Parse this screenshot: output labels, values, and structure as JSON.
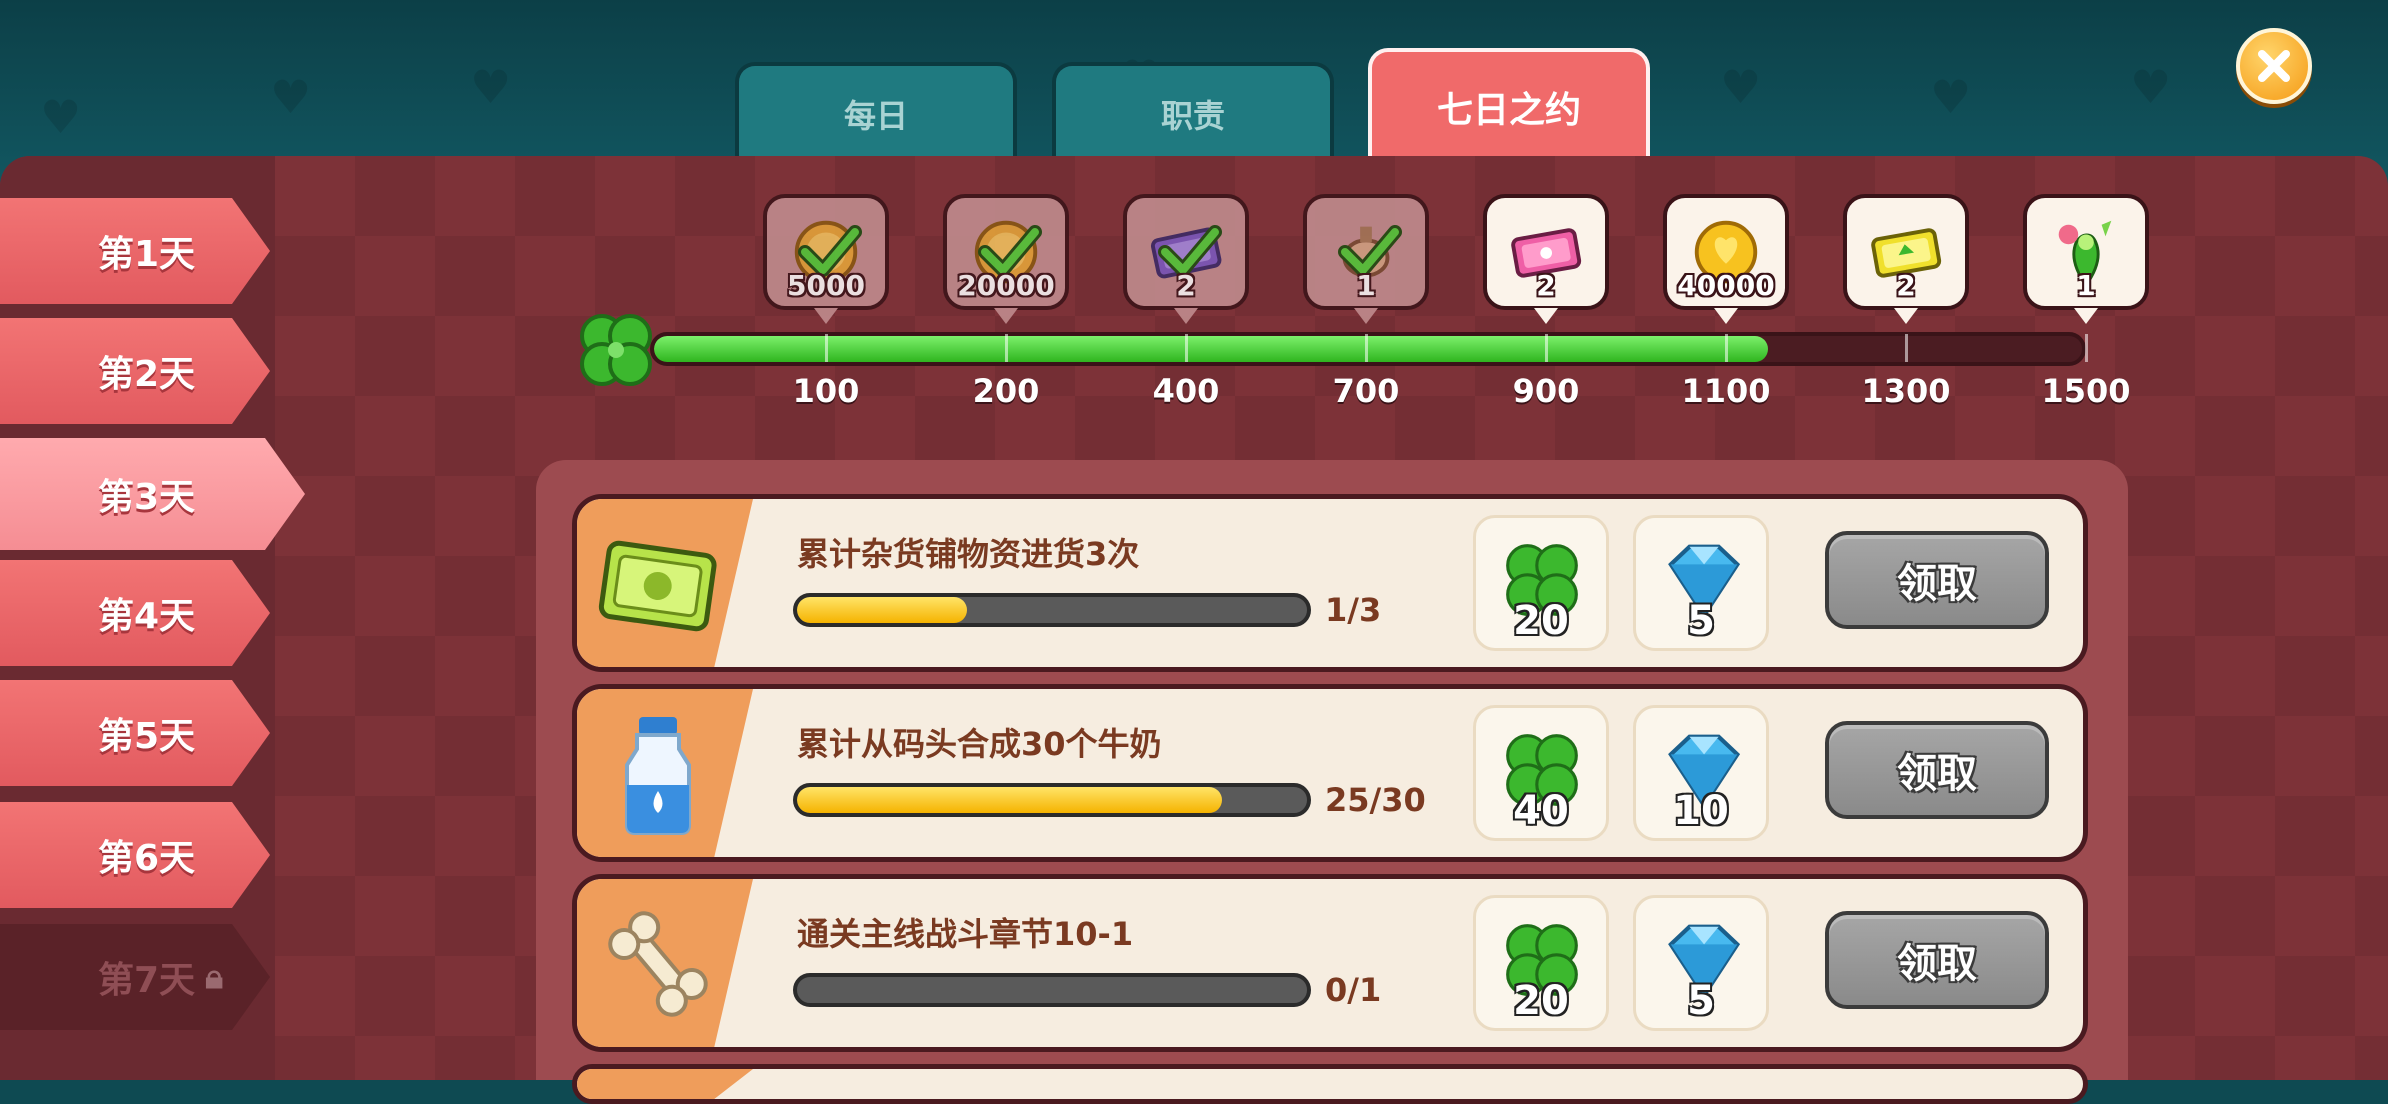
{
  "tabs": [
    {
      "label": "每日",
      "active": false
    },
    {
      "label": "职责",
      "active": false
    },
    {
      "label": "七日之约",
      "active": true
    }
  ],
  "days": [
    {
      "label": "第1天",
      "state": "normal"
    },
    {
      "label": "第2天",
      "state": "normal"
    },
    {
      "label": "第3天",
      "state": "selected"
    },
    {
      "label": "第4天",
      "state": "normal"
    },
    {
      "label": "第5天",
      "state": "normal"
    },
    {
      "label": "第6天",
      "state": "normal"
    },
    {
      "label": "第7天",
      "state": "locked"
    }
  ],
  "progress": {
    "current_fraction": 0.78,
    "thresholds": [
      "100",
      "200",
      "400",
      "700",
      "900",
      "1100",
      "1300",
      "1500"
    ],
    "milestones": [
      {
        "icon": "coin-icon",
        "count": "5000",
        "claimed": true
      },
      {
        "icon": "coin-icon",
        "count": "20000",
        "claimed": true
      },
      {
        "icon": "purple-ticket-icon",
        "count": "2",
        "claimed": true
      },
      {
        "icon": "decoration-icon",
        "count": "1",
        "claimed": true
      },
      {
        "icon": "pink-ticket-icon",
        "count": "2",
        "claimed": false
      },
      {
        "icon": "gold-coin-icon",
        "count": "40000",
        "claimed": false
      },
      {
        "icon": "yellow-ticket-icon",
        "count": "2",
        "claimed": false
      },
      {
        "icon": "plant-character-icon",
        "count": "1",
        "claimed": false
      }
    ]
  },
  "tasks": [
    {
      "icon": "green-ticket-icon",
      "title": "累计杂货铺物资进货3次",
      "progress_fraction": 0.333,
      "count": "1/3",
      "rewards": [
        {
          "icon": "clover-icon",
          "count": "20"
        },
        {
          "icon": "diamond-icon",
          "count": "5"
        }
      ],
      "button": "领取"
    },
    {
      "icon": "milk-bottle-icon",
      "title": "累计从码头合成30个牛奶",
      "progress_fraction": 0.833,
      "count": "25/30",
      "rewards": [
        {
          "icon": "clover-icon",
          "count": "40"
        },
        {
          "icon": "diamond-icon",
          "count": "10"
        }
      ],
      "button": "领取"
    },
    {
      "icon": "bone-icon",
      "title": "通关主线战斗章节10-1",
      "progress_fraction": 0,
      "count": "0/1",
      "rewards": [
        {
          "icon": "clover-icon",
          "count": "20"
        },
        {
          "icon": "diamond-icon",
          "count": "5"
        }
      ],
      "button": "领取"
    }
  ],
  "colors": {
    "accent": "#f06a6a",
    "progress_green": "#3cc42a",
    "task_progress_yellow": "#f5c000",
    "panel": "#7d3238"
  }
}
